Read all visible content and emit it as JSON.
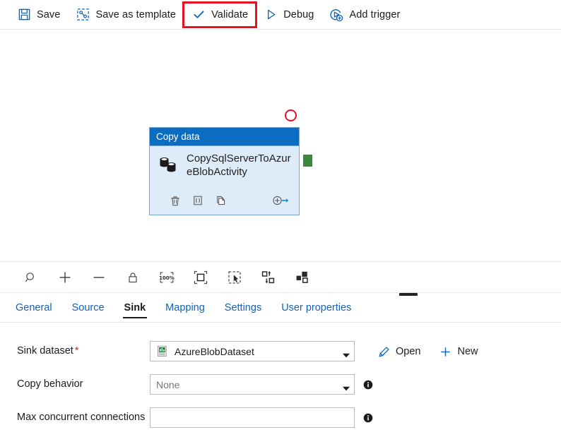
{
  "toolbar": {
    "items": [
      {
        "label": "Save",
        "icon": "save-icon",
        "highlighted": false
      },
      {
        "label": "Save as template",
        "icon": "save-template-icon",
        "highlighted": false
      },
      {
        "label": "Validate",
        "icon": "checkmark-icon",
        "highlighted": true
      },
      {
        "label": "Debug",
        "icon": "play-triangle-icon",
        "highlighted": false
      },
      {
        "label": "Add trigger",
        "icon": "add-trigger-icon",
        "highlighted": false
      }
    ],
    "highlight_color": "#e81123"
  },
  "canvas": {
    "node": {
      "header": "Copy data",
      "title": "CopySqlServerToAzureBlobActivity",
      "type_icon": "copy-data-databases-icon",
      "header_color": "#0c6cc1",
      "body_color": "#deecf9",
      "border_color": "#72a9d8",
      "actions": [
        {
          "name": "delete-activity",
          "icon": "trash-icon",
          "label": "Delete"
        },
        {
          "name": "view-code-activity",
          "icon": "code-braces-icon",
          "label": "Code"
        },
        {
          "name": "clone-activity",
          "icon": "duplicate-icon",
          "label": "Clone"
        },
        {
          "name": "add-output-activity",
          "icon": "add-output-icon",
          "label": "Add output"
        }
      ],
      "error_indicator": {
        "icon": "error-circle-icon",
        "color": "#e81123"
      },
      "output_port": {
        "icon": "output-port-square",
        "color": "#3b8a3b"
      }
    },
    "tools": [
      {
        "name": "search-canvas",
        "icon": "magnifier-icon"
      },
      {
        "name": "zoom-in",
        "icon": "plus-icon"
      },
      {
        "name": "zoom-out",
        "icon": "minus-icon"
      },
      {
        "name": "lock-canvas",
        "icon": "lock-icon"
      },
      {
        "name": "zoom-to-100",
        "icon": "zoom-100-percent-icon",
        "label": "100%"
      },
      {
        "name": "zoom-to-fit",
        "icon": "fit-to-screen-icon"
      },
      {
        "name": "select-region",
        "icon": "marquee-select-icon"
      },
      {
        "name": "auto-align",
        "icon": "auto-align-icon"
      },
      {
        "name": "auto-layout",
        "icon": "auto-layout-icon"
      }
    ],
    "drag_handle": "panel-resize-handle"
  },
  "tabs": [
    {
      "label": "General",
      "active": false
    },
    {
      "label": "Source",
      "active": false
    },
    {
      "label": "Sink",
      "active": true
    },
    {
      "label": "Mapping",
      "active": false
    },
    {
      "label": "Settings",
      "active": false
    },
    {
      "label": "User properties",
      "active": false
    }
  ],
  "properties": {
    "sink_dataset": {
      "label": "Sink dataset",
      "required": true,
      "required_mark": "*",
      "value": "AzureBlobDataset",
      "icon": "csv-dataset-icon",
      "open_button": {
        "label": "Open",
        "icon": "pencil-icon"
      },
      "new_button": {
        "label": "New",
        "icon": "plus-icon"
      }
    },
    "copy_behavior": {
      "label": "Copy behavior",
      "value": "None",
      "is_placeholder": true,
      "info": "info-icon"
    },
    "max_concurrent_connections": {
      "label": "Max concurrent connections",
      "value": "",
      "placeholder": "",
      "info": "info-icon"
    }
  }
}
